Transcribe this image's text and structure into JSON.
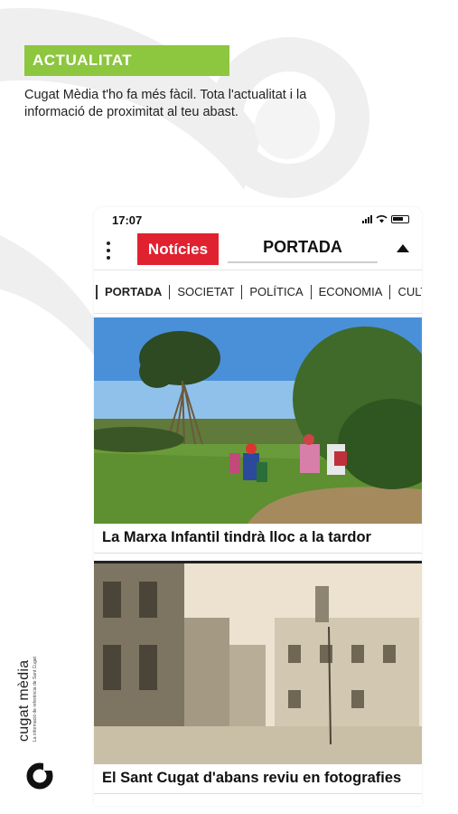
{
  "promo": {
    "badge": "ACTUALITAT",
    "text": "Cugat Mèdia t'ho fa més fàcil. Tota l'actualitat i la informació de proximitat al teu abast."
  },
  "status_bar": {
    "time": "17:07"
  },
  "app_bar": {
    "brand": "Notícies",
    "section": "PORTADA"
  },
  "tabs": [
    "PORTADA",
    "SOCIETAT",
    "POLÍTICA",
    "ECONOMIA",
    "CULTURA"
  ],
  "articles": [
    {
      "title": "La Marxa Infantil tindrà lloc a la tardor"
    },
    {
      "title": "El Sant Cugat d'abans reviu en fotografies"
    }
  ],
  "logo": {
    "name": "cugat mèdia",
    "tagline": "La informació de referència de Sant Cugat"
  },
  "colors": {
    "badge": "#8dc63f",
    "brand": "#e02130",
    "background_deco": "#eeeeee"
  },
  "icons": [
    "menu-icon",
    "signal-icon",
    "wifi-icon",
    "battery-icon",
    "up-arrow-icon",
    "cugat-media-logo-icon"
  ]
}
